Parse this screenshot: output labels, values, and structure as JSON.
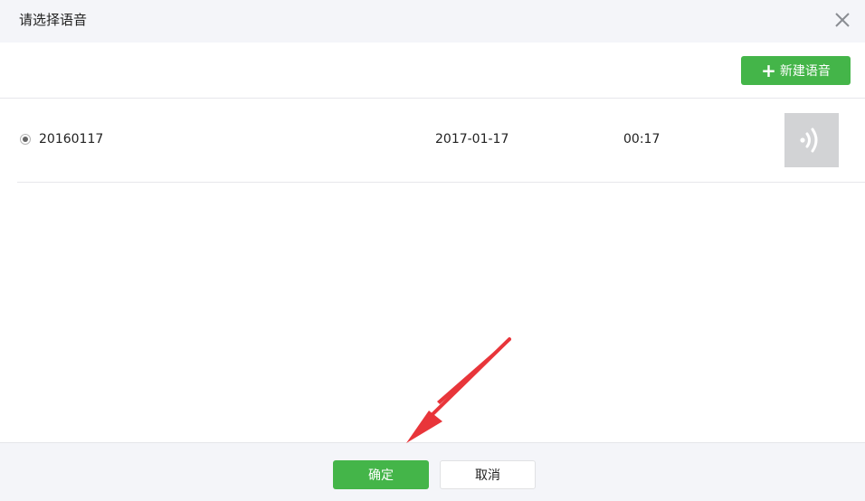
{
  "dialog": {
    "title": "请选择语音",
    "close_icon": "close-icon"
  },
  "toolbar": {
    "new_voice_label": "新建语音",
    "new_voice_icon": "plus-icon"
  },
  "voices": [
    {
      "name": "20160117",
      "date": "2017-01-17",
      "duration": "00:17",
      "selected": true,
      "thumb_icon": "audio-wave-icon"
    }
  ],
  "footer": {
    "confirm_label": "确定",
    "cancel_label": "取消"
  },
  "colors": {
    "accent_green": "#44b549",
    "header_bg": "#f4f5f9",
    "annotation_arrow": "#e8353a"
  }
}
